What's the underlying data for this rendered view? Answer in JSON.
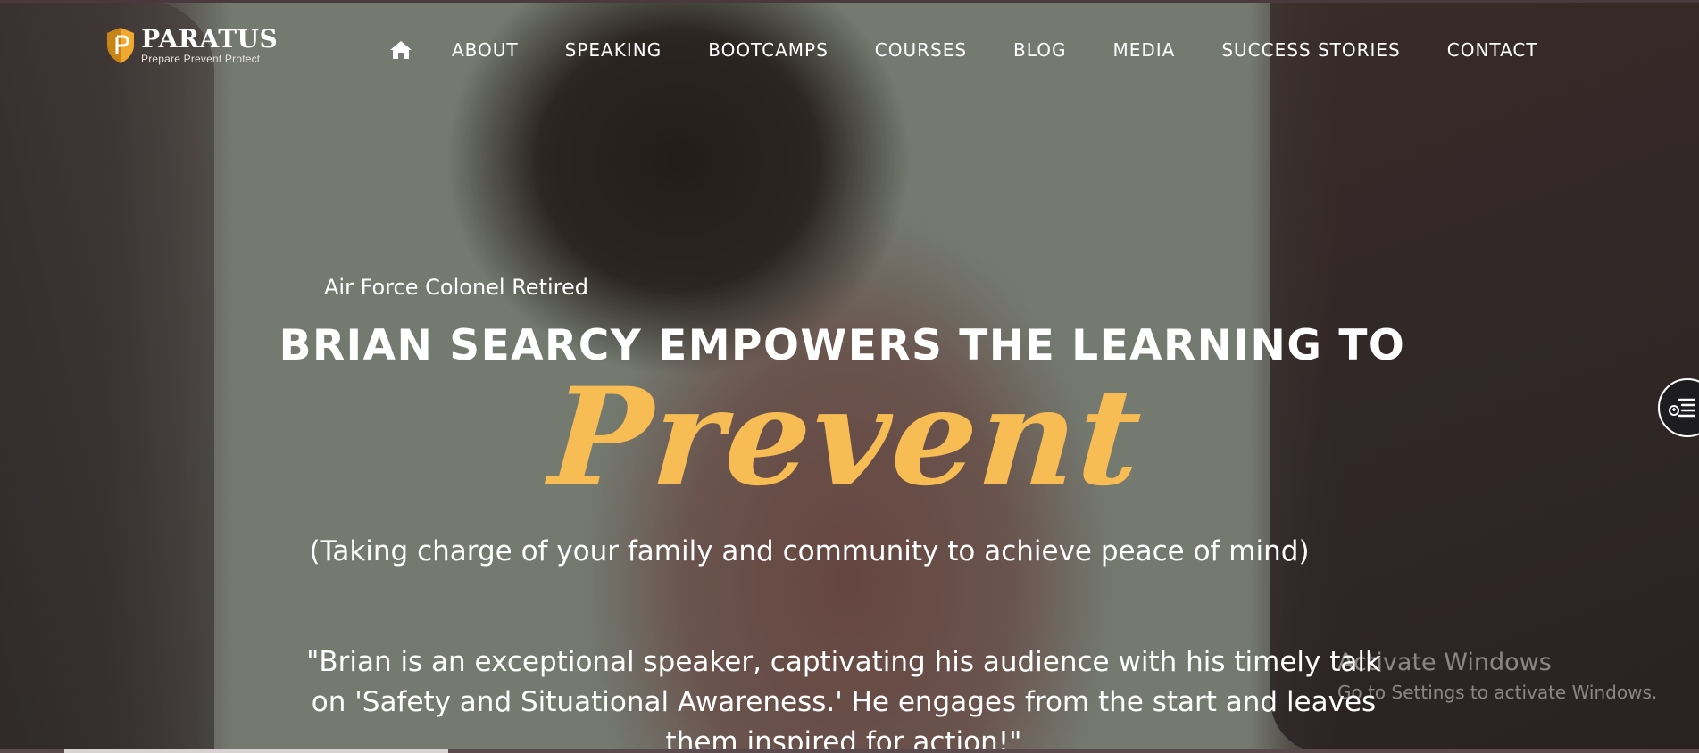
{
  "brand": {
    "name": "PARATUS",
    "tagline": "Prepare Prevent Protect",
    "shield_color": "#f0a92e"
  },
  "nav": {
    "home_icon": "home-icon",
    "items": [
      {
        "label": "ABOUT"
      },
      {
        "label": "SPEAKING"
      },
      {
        "label": "BOOTCAMPS"
      },
      {
        "label": "COURSES"
      },
      {
        "label": "BLOG"
      },
      {
        "label": "MEDIA"
      },
      {
        "label": "SUCCESS STORIES"
      },
      {
        "label": "CONTACT"
      }
    ]
  },
  "hero": {
    "eyebrow": "Air Force Colonel Retired",
    "headline": "BRIAN SEARCY EMPOWERS THE LEARNING TO",
    "accent_word": "Prevent",
    "accent_color": "#f7bd54",
    "subline": "(Taking charge of your family and community to achieve peace of mind)",
    "quote": "\"Brian is an exceptional speaker, captivating his audience with his timely talk on 'Safety and Situational Awareness.' He engages from the start and leaves them inspired for action!\""
  },
  "side_button": {
    "icon": "accessibility-menu-icon"
  },
  "watermark": {
    "title": "Activate Windows",
    "subtitle": "Go to Settings to activate Windows."
  }
}
